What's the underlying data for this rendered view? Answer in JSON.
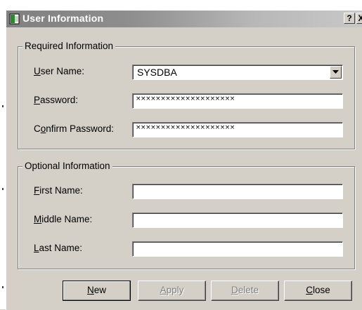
{
  "window": {
    "title": "User Information",
    "help_label": "?",
    "close_label": "X"
  },
  "required": {
    "legend": "Required Information",
    "user_name": {
      "label_prefix": "",
      "accel": "U",
      "label_rest": "ser Name:",
      "value": "SYSDBA"
    },
    "password": {
      "accel": "P",
      "label_rest": "assword:",
      "value": "××××××××××××××××××××"
    },
    "confirm": {
      "label_prefix": "C",
      "accel": "o",
      "label_rest": "nfirm Password:",
      "value": "××××××××××××××××××××"
    }
  },
  "optional": {
    "legend": "Optional Information",
    "first_name": {
      "accel": "F",
      "label_rest": "irst Name:",
      "value": ""
    },
    "middle_name": {
      "accel": "M",
      "label_rest": "iddle Name:",
      "value": ""
    },
    "last_name": {
      "accel": "L",
      "label_rest": "ast Name:",
      "value": ""
    }
  },
  "buttons": {
    "new": {
      "accel": "N",
      "rest": "ew"
    },
    "apply": {
      "accel": "A",
      "rest": "pply"
    },
    "delete": {
      "accel": "D",
      "rest": "elete"
    },
    "close": {
      "accel": "C",
      "rest": "lose"
    }
  },
  "icons": {
    "title_icon": "app-icon",
    "combo_arrow": "chevron-down-icon"
  },
  "colors": {
    "face": "#d4d0c8",
    "titlebar_inactive": "#808080",
    "disabled_text": "#808080"
  }
}
